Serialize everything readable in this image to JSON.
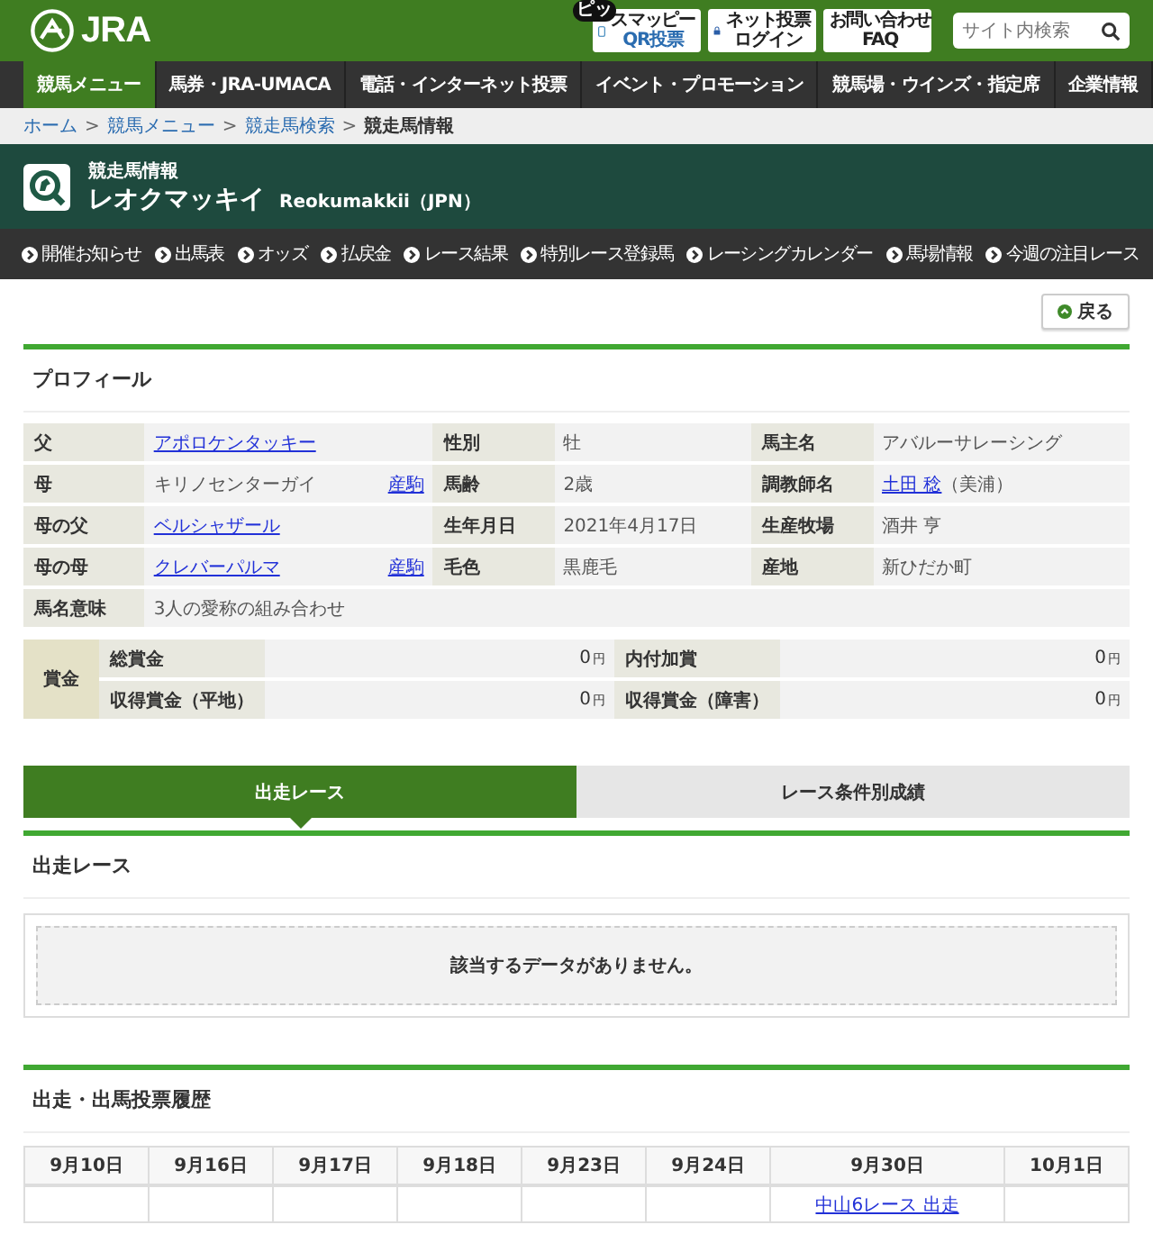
{
  "header": {
    "logo": "JRA",
    "buttons": [
      {
        "kind": "phone",
        "badge": "ピッ",
        "line1": "スマッピー",
        "line2": "QR投票"
      },
      {
        "kind": "lock",
        "line1": "ネット投票",
        "line2": "ログイン"
      },
      {
        "kind": "help",
        "line1": "お問い合わせ",
        "line2": "FAQ"
      }
    ],
    "search": {
      "placeholder": "サイト内検索"
    }
  },
  "main_nav": [
    {
      "label": "競馬メニュー",
      "selected": true
    },
    {
      "label": "馬券・JRA-UMACA",
      "selected": false
    },
    {
      "label": "電話・インターネット投票",
      "selected": false
    },
    {
      "label": "イベント・プロモーション",
      "selected": false
    },
    {
      "label": "競馬場・ウインズ・指定席",
      "selected": false
    },
    {
      "label": "企業情報",
      "selected": false
    }
  ],
  "breadcrumb": {
    "separator": ">",
    "items": [
      {
        "label": "ホーム",
        "link": true
      },
      {
        "label": "競馬メニュー",
        "link": true
      },
      {
        "label": "競走馬検索",
        "link": true
      },
      {
        "label": "競走馬情報",
        "link": false
      }
    ]
  },
  "page_header": {
    "category": "競走馬情報",
    "name": "レオクマッキイ",
    "name_en": "Reokumakkii（JPN）"
  },
  "sub_nav": [
    "開催お知らせ",
    "出馬表",
    "オッズ",
    "払戻金",
    "レース結果",
    "特別レース登録馬",
    "レーシングカレンダー",
    "馬場情報",
    "今週の注目レース"
  ],
  "back_button": "戻る",
  "profile": {
    "title": "プロフィール",
    "rows": [
      [
        {
          "label": "父",
          "value": "アポロケンタッキー",
          "link": true
        },
        {
          "label": "性別",
          "value": "牡",
          "link": false
        },
        {
          "label": "馬主名",
          "value": "アバルーサレーシング",
          "link": false
        }
      ],
      [
        {
          "label": "母",
          "value": "キリノセンターガイ",
          "link": false,
          "offspring": "産駒"
        },
        {
          "label": "馬齢",
          "value": "2歳",
          "link": false
        },
        {
          "label": "調教師名",
          "value": "土田 稔",
          "link": true,
          "note": "（美浦）"
        }
      ],
      [
        {
          "label": "母の父",
          "value": "ベルシャザール",
          "link": true
        },
        {
          "label": "生年月日",
          "value": "2021年4月17日",
          "link": false
        },
        {
          "label": "生産牧場",
          "value": "酒井 亨",
          "link": false
        }
      ],
      [
        {
          "label": "母の母",
          "value": "クレバーパルマ",
          "link": true,
          "offspring": "産駒"
        },
        {
          "label": "毛色",
          "value": "黒鹿毛",
          "link": false
        },
        {
          "label": "産地",
          "value": "新ひだか町",
          "link": false
        }
      ],
      [
        {
          "label": "馬名意味",
          "value": "3人の愛称の組み合わせ",
          "link": false
        }
      ]
    ]
  },
  "prize": {
    "label": "賞金",
    "rows": [
      [
        {
          "label": "総賞金",
          "value": "0",
          "unit": "円"
        },
        {
          "label": "内付加賞",
          "value": "0",
          "unit": "円"
        }
      ],
      [
        {
          "label": "収得賞金（平地）",
          "value": "0",
          "unit": "円"
        },
        {
          "label": "収得賞金（障害）",
          "value": "0",
          "unit": "円"
        }
      ]
    ]
  },
  "tabs": [
    {
      "label": "出走レース",
      "selected": true
    },
    {
      "label": "レース条件別成績",
      "selected": false
    }
  ],
  "races": {
    "title": "出走レース",
    "empty_message": "該当するデータがありません。"
  },
  "history": {
    "title": "出走・出馬投票履歴",
    "days": [
      {
        "date": "9月10日"
      },
      {
        "date": "9月16日"
      },
      {
        "date": "9月17日"
      },
      {
        "date": "9月18日"
      },
      {
        "date": "9月23日"
      },
      {
        "date": "9月24日"
      },
      {
        "date": "9月30日",
        "entry": "中山6レース 出走"
      },
      {
        "date": "10月1日"
      }
    ]
  }
}
